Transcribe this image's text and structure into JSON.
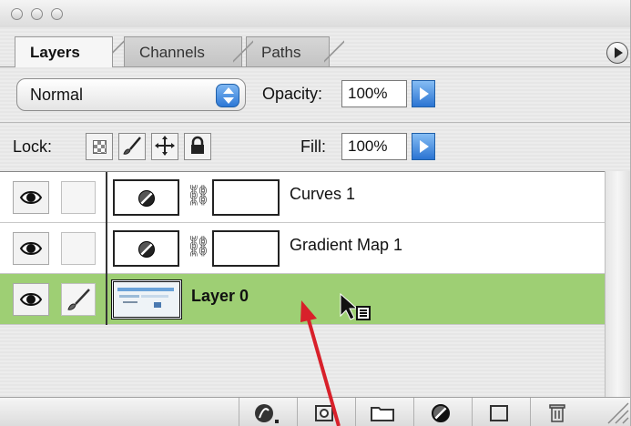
{
  "tabs": {
    "layers": "Layers",
    "channels": "Channels",
    "paths": "Paths"
  },
  "blend_mode": "Normal",
  "opacity": {
    "label": "Opacity:",
    "value": "100%"
  },
  "lock": {
    "label": "Lock:"
  },
  "fill": {
    "label": "Fill:",
    "value": "100%"
  },
  "layers": [
    {
      "name": "Curves 1",
      "type": "adjustment",
      "visible": true,
      "selected": false
    },
    {
      "name": "Gradient Map 1",
      "type": "adjustment",
      "visible": true,
      "selected": false
    },
    {
      "name": "Layer 0",
      "type": "image",
      "visible": true,
      "selected": true
    }
  ],
  "colors": {
    "selected_row": "#9ecf74",
    "accent_blue": "#2d78d6",
    "annotation_arrow": "#d8202a"
  },
  "icons": {
    "window": [
      "close-icon",
      "minimize-icon",
      "zoom-icon"
    ],
    "lock": [
      "lock-transparent-icon",
      "lock-paint-icon",
      "lock-move-icon",
      "lock-all-icon"
    ],
    "bottom": [
      "layer-style-icon",
      "add-mask-icon",
      "new-group-icon",
      "adjustment-layer-icon",
      "new-layer-icon",
      "trash-icon"
    ]
  }
}
